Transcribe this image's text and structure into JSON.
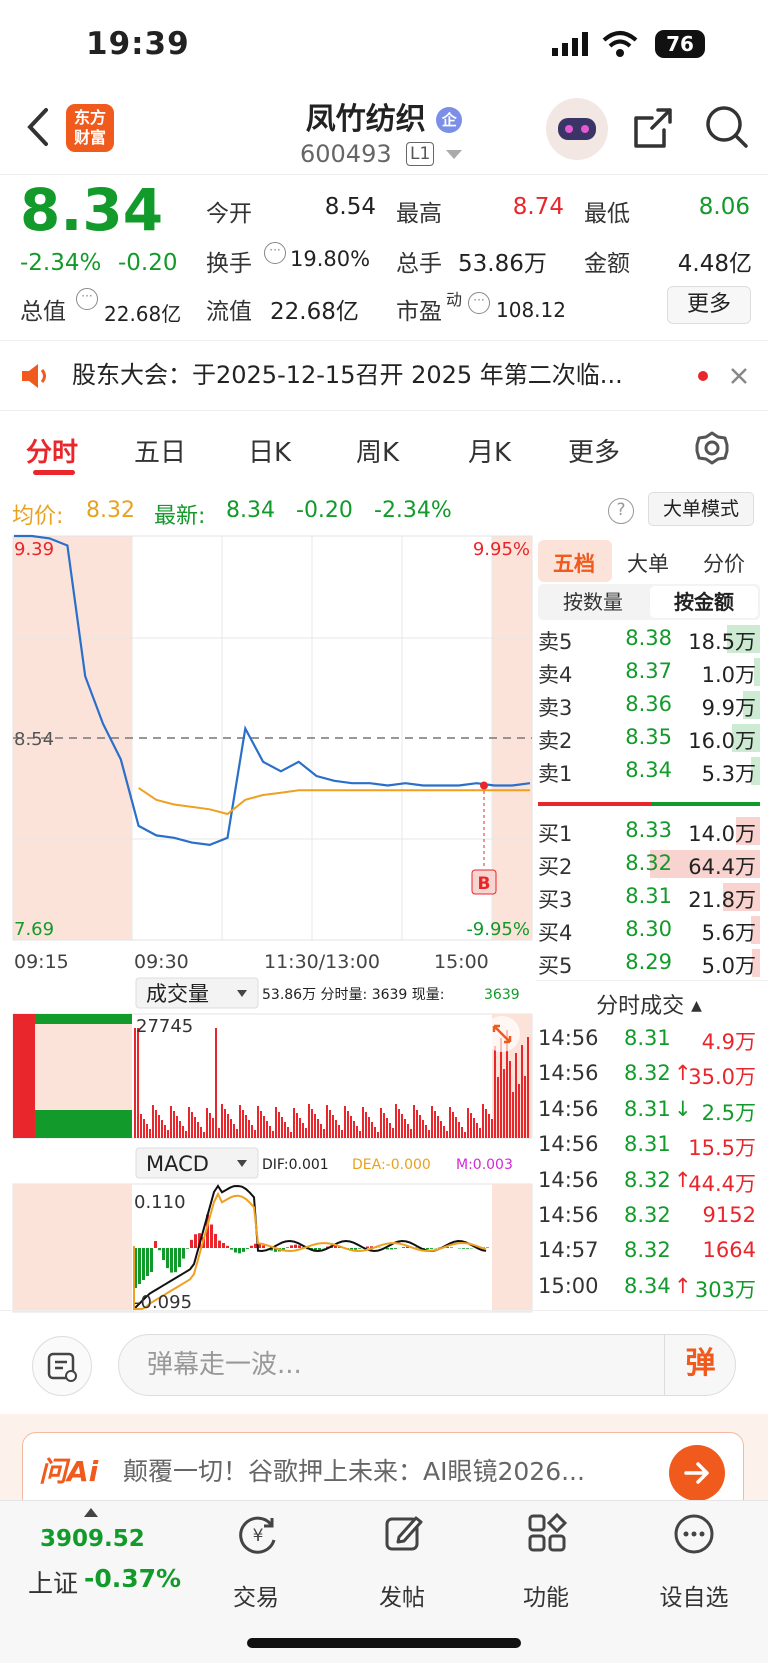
{
  "status": {
    "time": "19:39",
    "battery": "76"
  },
  "header": {
    "title": "凤竹纺织",
    "badge": "企",
    "code": "600493",
    "level": "L1",
    "logo_line1": "东方",
    "logo_line2": "财富"
  },
  "quote": {
    "price": "8.34",
    "change_pct": "-2.34%",
    "change": "-0.20",
    "open_label": "今开",
    "open": "8.54",
    "high_label": "最高",
    "high": "8.74",
    "low_label": "最低",
    "low": "8.06",
    "turnover_label": "换手",
    "turnover": "19.80%",
    "volume_label": "总手",
    "volume": "53.86万",
    "amount_label": "金额",
    "amount": "4.48亿",
    "mcap_label": "总值",
    "mcap": "22.68亿",
    "float_label": "流值",
    "float": "22.68亿",
    "pe_label": "市盈",
    "pe_sup": "动",
    "pe": "108.12",
    "more": "更多"
  },
  "notice": {
    "text": "股东大会：于2025-12-15召开 2025 年第二次临..."
  },
  "tabs": [
    "分时",
    "五日",
    "日K",
    "周K",
    "月K",
    "更多"
  ],
  "info": {
    "avg_label": "均价:",
    "avg": "8.32",
    "latest_label": "最新:",
    "latest": "8.34",
    "chg": "-0.20",
    "pct": "-2.34%",
    "mode_btn": "大单模式"
  },
  "chart": {
    "y_max": "9.39",
    "y_max_pct": "9.95%",
    "y_mid": "8.54",
    "y_min": "7.69",
    "y_min_pct": "-9.95%",
    "x_labels": [
      "09:15",
      "09:30",
      "11:30/13:00",
      "15:00"
    ],
    "marker": "B",
    "vol_label": "成交量",
    "vol_info": "53.86万 分时量: 3639 现量:",
    "vol_now": "3639",
    "vol_max": "27745",
    "macd_label": "MACD",
    "dif": "DIF:0.001",
    "dea": "DEA:-0.000",
    "m": "M:0.003",
    "macd_max": "0.110",
    "macd_min": "-0.095"
  },
  "chart_data": {
    "type": "line",
    "series": [
      {
        "name": "最新",
        "values": [
          9.39,
          9.39,
          9.38,
          9.35,
          8.8,
          8.6,
          8.45,
          8.17,
          8.13,
          8.12,
          8.1,
          8.09,
          8.12,
          8.58,
          8.44,
          8.4,
          8.44,
          8.38,
          8.36,
          8.35,
          8.35,
          8.34,
          8.35,
          8.34,
          8.34,
          8.34,
          8.35,
          8.34,
          8.34,
          8.35
        ]
      },
      {
        "name": "均价",
        "values": [
          null,
          null,
          null,
          null,
          null,
          null,
          null,
          8.33,
          8.28,
          8.26,
          8.25,
          8.24,
          8.22,
          8.28,
          8.3,
          8.31,
          8.32,
          8.32,
          8.32,
          8.32,
          8.32,
          8.32,
          8.32,
          8.32,
          8.32,
          8.32,
          8.32,
          8.32,
          8.32,
          8.32
        ]
      }
    ],
    "ylim": [
      7.69,
      9.39
    ],
    "ref": 8.54
  },
  "orderbook": {
    "tabs": [
      "五档",
      "大单",
      "分价"
    ],
    "seg": [
      "按数量",
      "按金额"
    ],
    "asks": [
      {
        "label": "卖5",
        "price": "8.38",
        "vol": "18.5万",
        "share": 0.3
      },
      {
        "label": "卖4",
        "price": "8.37",
        "vol": "1.0万",
        "share": 0.02
      },
      {
        "label": "卖3",
        "price": "8.36",
        "vol": "9.9万",
        "share": 0.15
      },
      {
        "label": "卖2",
        "price": "8.35",
        "vol": "16.0万",
        "share": 0.25
      },
      {
        "label": "卖1",
        "price": "8.34",
        "vol": "5.3万",
        "share": 0.08
      }
    ],
    "bids": [
      {
        "label": "买1",
        "price": "8.33",
        "vol": "14.0万",
        "share": 0.22
      },
      {
        "label": "买2",
        "price": "8.32",
        "vol": "64.4万",
        "share": 1.0
      },
      {
        "label": "买3",
        "price": "8.31",
        "vol": "21.8万",
        "share": 0.34
      },
      {
        "label": "买4",
        "price": "8.30",
        "vol": "5.6万",
        "share": 0.08
      },
      {
        "label": "买5",
        "price": "8.29",
        "vol": "5.0万",
        "share": 0.07
      }
    ]
  },
  "ticks": {
    "title": "分时成交",
    "rows": [
      {
        "time": "14:56",
        "price": "8.31",
        "arrow": "",
        "vol": "4.9万",
        "pc": "green",
        "vc": "red"
      },
      {
        "time": "14:56",
        "price": "8.32",
        "arrow": "↑",
        "vol": "35.0万",
        "pc": "green",
        "vc": "red"
      },
      {
        "time": "14:56",
        "price": "8.31",
        "arrow": "↓",
        "vol": "2.5万",
        "pc": "green",
        "vc": "green"
      },
      {
        "time": "14:56",
        "price": "8.31",
        "arrow": "",
        "vol": "15.5万",
        "pc": "green",
        "vc": "red"
      },
      {
        "time": "14:56",
        "price": "8.32",
        "arrow": "↑",
        "vol": "44.4万",
        "pc": "green",
        "vc": "red"
      },
      {
        "time": "14:56",
        "price": "8.32",
        "arrow": "",
        "vol": "9152",
        "pc": "green",
        "vc": "red"
      },
      {
        "time": "14:57",
        "price": "8.32",
        "arrow": "",
        "vol": "1664",
        "pc": "green",
        "vc": "red"
      },
      {
        "time": "15:00",
        "price": "8.34",
        "arrow": "↑",
        "vol": "303万",
        "pc": "green",
        "vc": "green"
      }
    ]
  },
  "danmu": {
    "placeholder": "弹幕走一波...",
    "btn": "弹"
  },
  "ai_banner": {
    "logo": "问Ai",
    "text": "颠覆一切！谷歌押上未来：AI眼镜2026..."
  },
  "bottom_nav": {
    "index_value": "3909.52",
    "index_name": "上证",
    "index_pct": "-0.37%",
    "items": [
      "交易",
      "发帖",
      "功能",
      "设自选"
    ]
  },
  "colors": {
    "up": "#e8262b",
    "down": "#129a2a",
    "accent": "#f05a1c"
  }
}
